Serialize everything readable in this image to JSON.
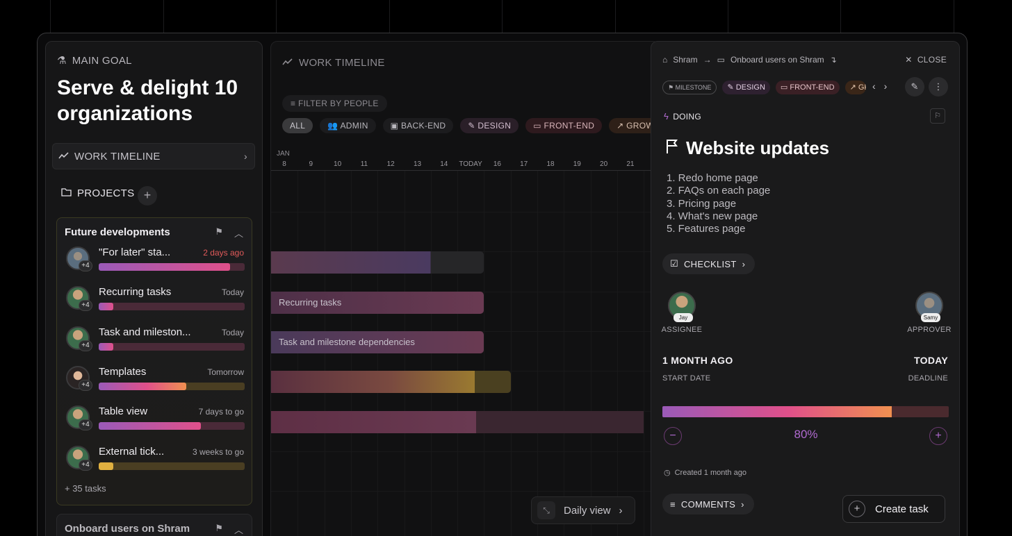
{
  "sidebar": {
    "main_goal_label": "MAIN GOAL",
    "goal_title": "Serve & delight 10 organizations",
    "work_timeline_label": "WORK TIMELINE",
    "projects_label": "PROJECTS",
    "project": {
      "title": "Future developments",
      "tasks": [
        {
          "name": "\"For later\" sta...",
          "when": "2 days ago",
          "avatar_badge": "+4",
          "progress": 0.9
        },
        {
          "name": "Recurring tasks",
          "when": "Today",
          "avatar_badge": "+4",
          "progress": 0.1
        },
        {
          "name": "Task and mileston...",
          "when": "Today",
          "avatar_badge": "+4",
          "progress": 0.1
        },
        {
          "name": "Templates",
          "when": "Tomorrow",
          "avatar_badge": "+4",
          "progress": 0.6
        },
        {
          "name": "Table view",
          "when": "7 days to go",
          "avatar_badge": "+4",
          "progress": 0.7
        },
        {
          "name": "External tick...",
          "when": "3 weeks to go",
          "avatar_badge": "+4",
          "progress": 0.1
        }
      ],
      "more_tasks": "+ 35 tasks"
    },
    "project2_title": "Onboard users on Shram"
  },
  "timeline": {
    "title": "WORK TIMELINE",
    "filter_label": "FILTER BY PEOPLE",
    "chips": [
      "ALL",
      "ADMIN",
      "BACK-END",
      "DESIGN",
      "FRONT-END",
      "GROWTH"
    ],
    "month": "JAN",
    "days": [
      "8",
      "9",
      "10",
      "11",
      "12",
      "13",
      "14",
      "TODAY",
      "16",
      "17",
      "18",
      "19",
      "20",
      "21"
    ],
    "bars": [
      {
        "label": "",
        "span_days": 8
      },
      {
        "label": "Recurring tasks",
        "span_days": 8
      },
      {
        "label": "Task and milestone dependencies",
        "span_days": 8
      },
      {
        "label": "",
        "span_days": 9
      },
      {
        "label": "",
        "span_days": 14
      }
    ],
    "daily_view_label": "Daily view"
  },
  "detail": {
    "breadcrumb_workspace": "Shram",
    "breadcrumb_project": "Onboard users on Shram",
    "close_label": "CLOSE",
    "tags": [
      "MILESTONE",
      "DESIGN",
      "FRONT-END",
      "GROWTH"
    ],
    "status": "DOING",
    "title": "Website updates",
    "steps": [
      "1. Redo home page",
      "2. FAQs on each page",
      "3. Pricing page",
      "4. What's new page",
      "5. Features page"
    ],
    "checklist_label": "CHECKLIST",
    "assignee_name": "Jay",
    "assignee_role": "ASSIGNEE",
    "approver_name": "Samy",
    "approver_role": "APPROVER",
    "start_date_value": "1 MONTH AGO",
    "start_date_label": "START DATE",
    "deadline_value": "TODAY",
    "deadline_label": "DEADLINE",
    "progress_percent": "80%",
    "progress_value": 0.8,
    "created_label": "Created 1 month ago",
    "comments_label": "COMMENTS",
    "create_task_label": "Create task"
  }
}
